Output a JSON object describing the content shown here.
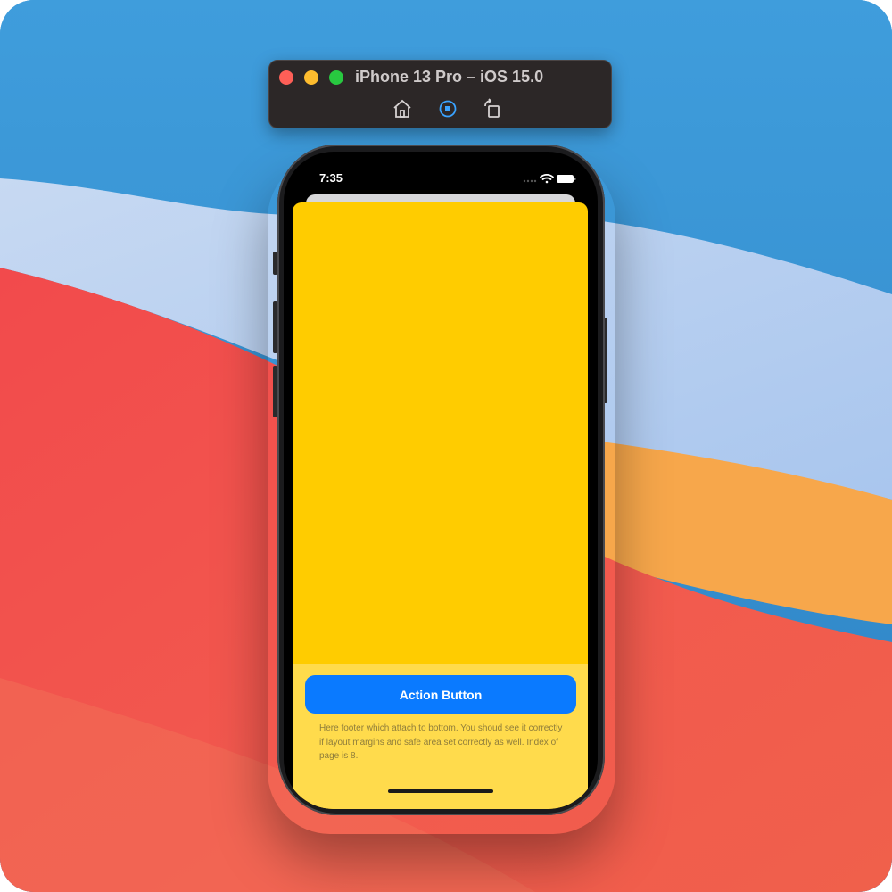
{
  "simulator": {
    "title": "iPhone 13 Pro – iOS 15.0",
    "toolbar": [
      "home",
      "screenshot",
      "rotate"
    ]
  },
  "status_bar": {
    "time": "7:35"
  },
  "footer": {
    "action_button_label": "Action Button",
    "description": "Here footer which attach to bottom. You shoud see it correctly if layout margins and safe area set correctly as well. Index of page is 8."
  },
  "colors": {
    "sheet": "#ffcc00",
    "footer": "#ffdb4c",
    "button": "#0a7aff"
  }
}
